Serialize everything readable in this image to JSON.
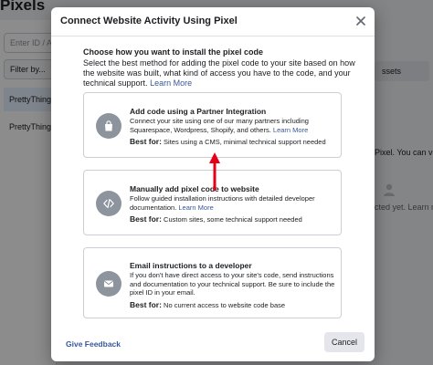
{
  "background": {
    "page_title": "Pixels",
    "search_placeholder": "Enter ID / A",
    "filter_label": "Filter by...",
    "sidebar_items": [
      "PrettyThings",
      "PrettyThings"
    ],
    "assets_button": "ssets",
    "pixel_text": "Pixel. You can vie",
    "status_text": "cted yet. Learn m"
  },
  "modal": {
    "title": "Connect Website Activity Using Pixel",
    "intro_heading": "Choose how you want to install the pixel code",
    "intro_text": "Select the best method for adding the pixel code to your site based on how the website was built, what kind of access you have to the code, and your technical support.",
    "intro_link": "Learn More",
    "options": [
      {
        "icon": "shopping-bag-icon",
        "title": "Add code using a Partner Integration",
        "desc": "Connect your site using one of our many partners including Squarespace, Wordpress, Shopify, and others.",
        "link": "Learn More",
        "best_label": "Best for:",
        "best_text": "Sites using a CMS, minimal technical support needed"
      },
      {
        "icon": "code-icon",
        "title": "Manually add pixel code to website",
        "desc": "Follow guided installation instructions with detailed developer documentation.",
        "link": "Learn More",
        "best_label": "Best for:",
        "best_text": "Custom sites, some technical support needed"
      },
      {
        "icon": "envelope-icon",
        "title": "Email instructions to a developer",
        "desc": "If you don't have direct access to your site's code, send instructions and documentation to your technical support. Be sure to include the pixel ID in your email.",
        "link": "",
        "best_label": "Best for:",
        "best_text": "No current access to website code base"
      }
    ],
    "feedback_link": "Give Feedback",
    "cancel_label": "Cancel"
  },
  "colors": {
    "link": "#385898",
    "arrow": "#e4001b",
    "icon_circle": "#8d949e"
  }
}
